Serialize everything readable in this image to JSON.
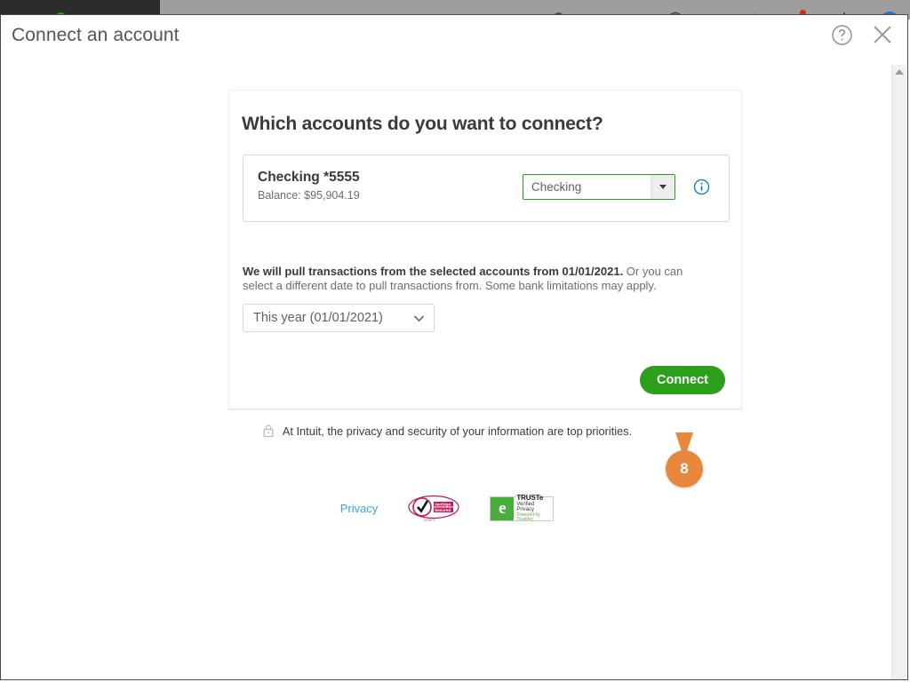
{
  "app_chrome": {
    "icons": [
      "search-icon",
      "help-icon",
      "notifications-bell-icon",
      "settings-gear-icon",
      "user-avatar"
    ]
  },
  "modal": {
    "title": "Connect an account",
    "help_icon": "help-circle-icon",
    "close_icon": "close-icon"
  },
  "card": {
    "heading": "Which accounts do you want to connect?",
    "accounts": [
      {
        "name": "Checking *5555",
        "balance": "Balance: $95,904.19",
        "account_type": "Checking",
        "info_icon": "info-circle-icon"
      }
    ],
    "date_note": {
      "bold": "We will pull transactions from the selected accounts from 01/01/2021.",
      "rest": " Or you can select a different date to pull transactions from. Some bank limitations may apply."
    },
    "date_range_value": "This year (01/01/2021)",
    "connect_label": "Connect"
  },
  "callout": {
    "step_number": "8"
  },
  "footer": {
    "lock_icon": "lock-icon",
    "note": "At Intuit, the privacy and security of your information are top priorities.",
    "privacy_link": "Privacy",
    "verisign": {
      "line1": "VeriSign",
      "line2": "Secured",
      "line3": "VERIFY"
    },
    "truste": {
      "logo_letter": "e",
      "line1": "TRUSTe",
      "line2": "Verified Privacy",
      "line3": "Powered by TrustArc"
    }
  },
  "colors": {
    "brand_green": "#2ca01c",
    "link_blue": "#3aa2e0",
    "info_blue": "#0077c5",
    "callout_orange": "#e8873b",
    "text_dark": "#393a3d",
    "text_muted": "#6b6c72"
  }
}
